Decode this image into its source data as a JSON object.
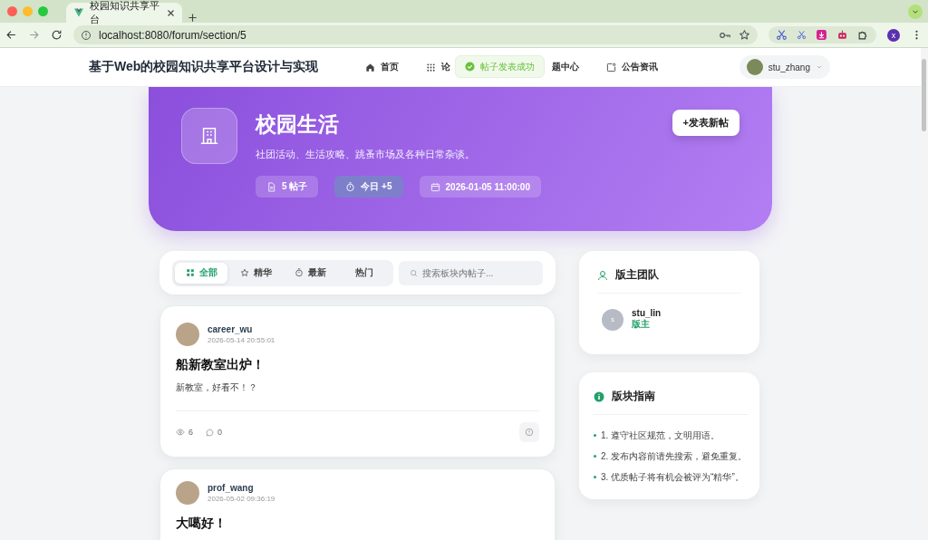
{
  "browser": {
    "tab_title": "校园知识共享平台",
    "url": "localhost:8080/forum/section/5",
    "profile_initial": "x"
  },
  "header": {
    "site_title": "基于Web的校园知识共享平台设计与实现",
    "nav": [
      {
        "label": "首页"
      },
      {
        "label": "论"
      },
      {
        "label": "题中心"
      },
      {
        "label": "公告资讯"
      }
    ],
    "user": {
      "name": "stu_zhang"
    }
  },
  "toast": {
    "text": "帖子发表成功"
  },
  "section": {
    "title": "校园生活",
    "description": "社团活动、生活攻略、跳蚤市场及各种日常杂谈。",
    "new_post_button": "+发表新帖",
    "stats": [
      {
        "kind": "posts",
        "text": "5 帖子"
      },
      {
        "kind": "today",
        "text": "今日 +5"
      },
      {
        "kind": "date",
        "text": "2026-01-05 11:00:00"
      }
    ]
  },
  "filters": {
    "tabs": [
      {
        "label": "全部",
        "selected": true
      },
      {
        "label": "精华",
        "selected": false
      },
      {
        "label": "最新",
        "selected": false
      },
      {
        "label": "热门",
        "selected": false
      }
    ],
    "search": {
      "placeholder": "搜索板块内帖子..."
    }
  },
  "posts": [
    {
      "author": "career_wu",
      "time": "2026-05-14 20:55:01",
      "title": "船新教室出炉！",
      "body": "新教室，好看不！？",
      "views": "6",
      "comments": "0"
    },
    {
      "author": "prof_wang",
      "time": "2026-05-02 09:36:19",
      "title": "大噶好！"
    }
  ],
  "moderators": {
    "title": "版主团队",
    "members": [
      {
        "initial": "s",
        "name": "stu_lin",
        "role": "版主"
      }
    ]
  },
  "guide": {
    "title": "版块指南",
    "items": [
      "1. 遵守社区规范，文明用语。",
      "2. 发布内容前请先搜索，避免重复。",
      "3. 优质帖子将有机会被评为“精华”。"
    ]
  }
}
